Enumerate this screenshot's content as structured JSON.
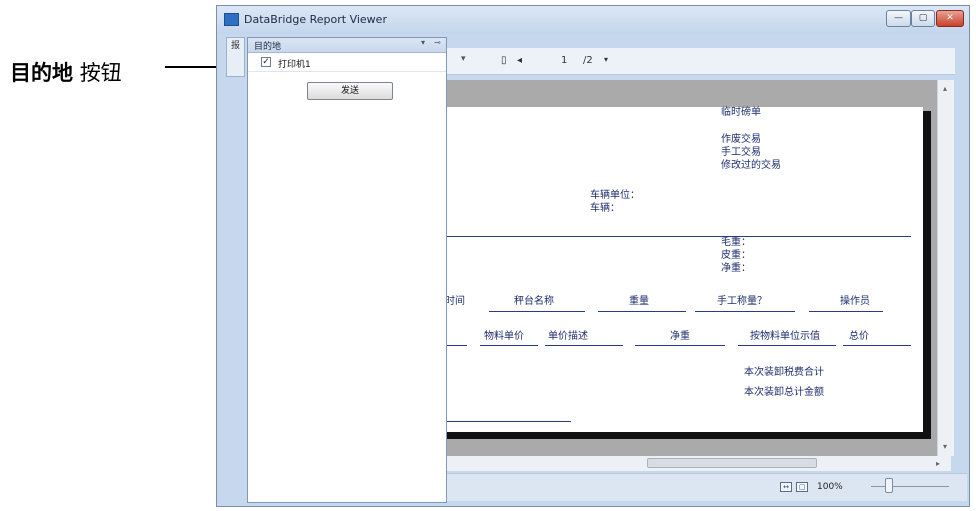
{
  "annotation": {
    "bold": "目的地",
    "rest": "按钮"
  },
  "window": {
    "title": "DataBridge Report Viewer",
    "min": "—",
    "max": "▢",
    "close": "✕",
    "strip_label": "报"
  },
  "toolbar": {
    "page_current": "1",
    "page_total": "/2"
  },
  "destination_panel": {
    "title": "目的地",
    "printer": "打印机1",
    "send_label": "发送"
  },
  "report": {
    "doc_title": "临时磅单",
    "trans_types": [
      "作废交易",
      "手工交易",
      "修改过的交易"
    ],
    "vehicle_unit": "车辆单位：",
    "vehicle": "车辆：",
    "gross": "毛重：",
    "tare": "皮重：",
    "net": "净重：",
    "row1_headers": [
      "时间",
      "秤台名称",
      "重量",
      "手工称量？",
      "操作员"
    ],
    "row2_headers": [
      "物料单价",
      "单价描述",
      "净重",
      "按物料单位示值",
      "总价"
    ],
    "tax_total": "本次装卸税费合计",
    "grand_total": "本次装卸总计金额"
  },
  "statusbar": {
    "zoom": "100%"
  },
  "colors": {
    "report_text": "#1f2e6e",
    "window_frame": "#c6d8ee",
    "accent": "#2e6fc4"
  }
}
